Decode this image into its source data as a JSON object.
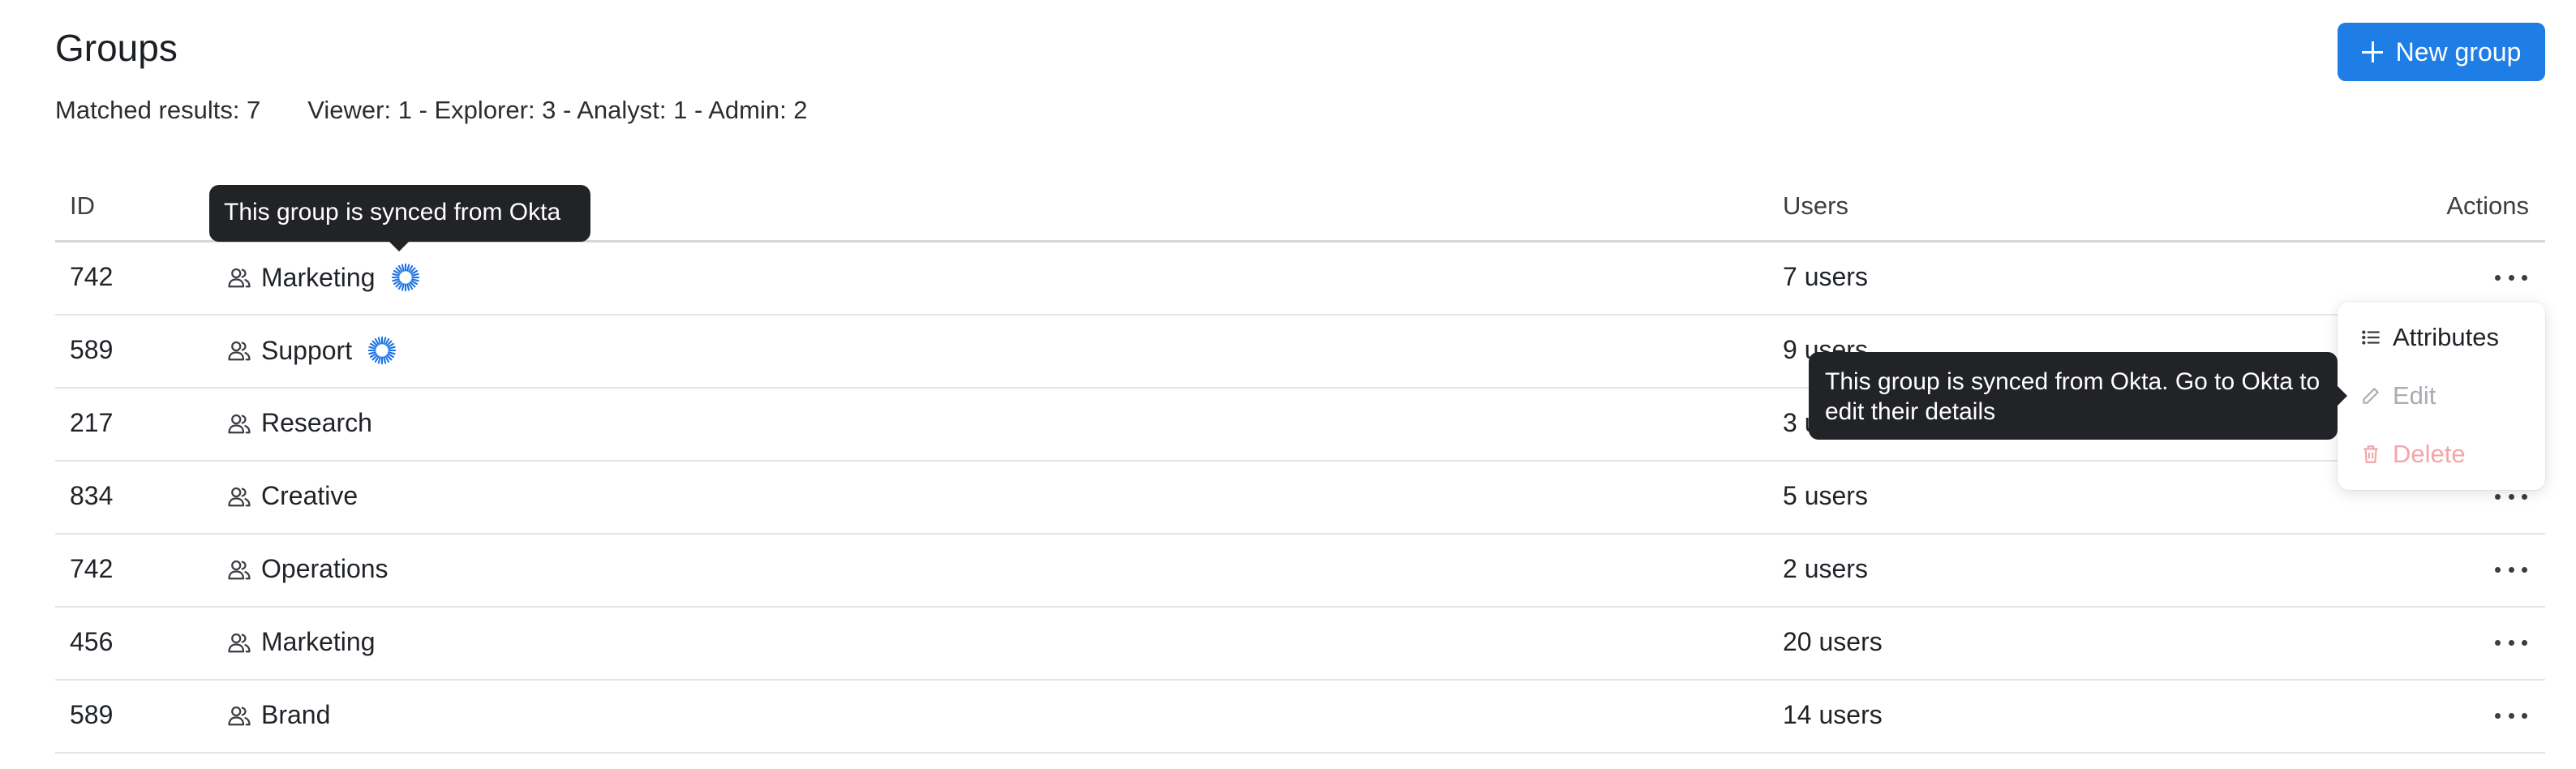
{
  "header": {
    "title": "Groups",
    "new_group_label": "New group"
  },
  "summary": {
    "matched": "Matched results: 7",
    "roles": "Viewer: 1 - Explorer: 3 - Analyst: 1 - Admin: 2"
  },
  "table": {
    "columns": {
      "id": "ID",
      "users": "Users",
      "actions": "Actions"
    },
    "rows": [
      {
        "id": "742",
        "name": "Marketing",
        "users": "7 users",
        "synced": true
      },
      {
        "id": "589",
        "name": "Support",
        "users": "9 users",
        "synced": true
      },
      {
        "id": "217",
        "name": "Research",
        "users": "3 users",
        "synced": false
      },
      {
        "id": "834",
        "name": "Creative",
        "users": "5 users",
        "synced": false
      },
      {
        "id": "742",
        "name": "Operations",
        "users": "2 users",
        "synced": false
      },
      {
        "id": "456",
        "name": "Marketing",
        "users": "20 users",
        "synced": false
      },
      {
        "id": "589",
        "name": "Brand",
        "users": "14 users",
        "synced": false
      }
    ]
  },
  "tooltips": {
    "synced": "This group is synced from Okta",
    "synced_edit": "This group is synced from Okta. Go to Okta to edit their details"
  },
  "actions_menu": {
    "attributes": "Attributes",
    "edit": "Edit",
    "delete": "Delete"
  },
  "colors": {
    "accent": "#1f7de6",
    "okta_blue": "#1a73e8",
    "tooltip_bg": "#222326",
    "delete_disabled": "#f2a7a7"
  }
}
